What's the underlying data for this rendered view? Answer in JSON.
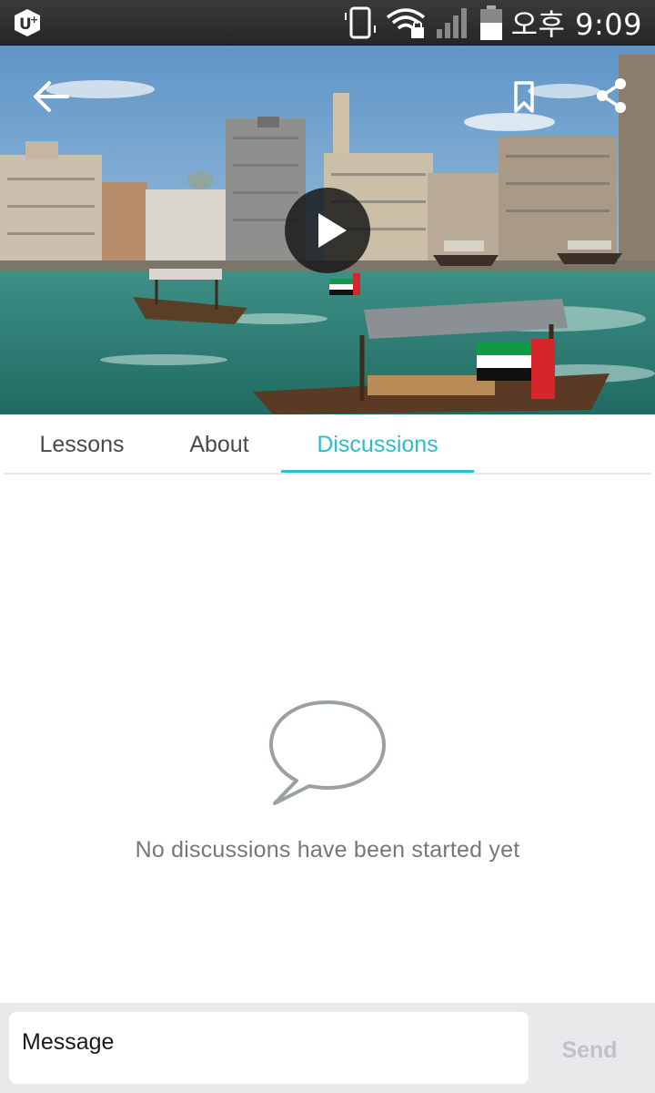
{
  "status_bar": {
    "time": "오후 9:09",
    "icons": [
      "carrier-logo-icon",
      "vibrate-icon",
      "wifi-lock-icon",
      "signal-icon",
      "battery-icon"
    ]
  },
  "hero": {
    "icons": [
      "back-arrow-icon",
      "bookmark-icon",
      "share-icon",
      "play-icon"
    ]
  },
  "tabs": {
    "items": [
      {
        "label": "Lessons"
      },
      {
        "label": "About"
      },
      {
        "label": "Discussions"
      }
    ],
    "active": "Discussions",
    "accent_color": "#2bbdc9"
  },
  "empty_state": {
    "icon": "speech-bubble-icon",
    "text": "No discussions have been started yet"
  },
  "composer": {
    "placeholder": "Message",
    "send_label": "Send"
  }
}
